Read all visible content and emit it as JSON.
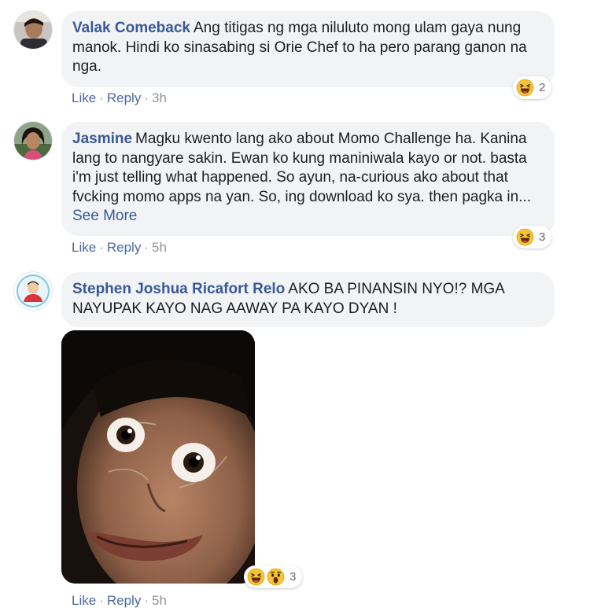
{
  "comments": [
    {
      "author": "Valak Comeback",
      "text": "Ang titigas ng mga niluluto mong ulam gaya nung manok. Hindi ko sinasabing si Orie Chef to ha pero parang ganon na nga.",
      "actions": {
        "like": "Like",
        "reply": "Reply",
        "sep": "·",
        "time": "3h"
      },
      "reactions": {
        "icons": [
          "haha-icon"
        ],
        "count": "2"
      }
    },
    {
      "author": "Jasmine",
      "text": "Magku kwento lang ako about Momo Challenge ha. Kanina lang to nangyare sakin. Ewan ko kung maniniwala kayo or not. basta i'm just telling what happened. So ayun, na-curious ako about that fvcking momo apps na yan. So, ing download ko sya. then pagka in...",
      "see_more": "See More",
      "actions": {
        "like": "Like",
        "reply": "Reply",
        "sep": "·",
        "time": "5h"
      },
      "reactions": {
        "icons": [
          "haha-icon"
        ],
        "count": "3"
      }
    },
    {
      "author": "Stephen Joshua Ricafort Relo",
      "text": "AKO BA PINANSIN NYO!? MGA NAYUPAK KAYO NAG AAWAY PA KAYO DYAN !",
      "actions": {
        "like": "Like",
        "reply": "Reply",
        "sep": "·",
        "time": "5h"
      },
      "reactions": {
        "icons": [
          "haha-icon",
          "wow-icon"
        ],
        "count": "3"
      }
    }
  ],
  "colors": {
    "author": "#385898",
    "bubble": "#f2f3f5",
    "action_link": "#4b67a1",
    "meta": "#90949c"
  }
}
